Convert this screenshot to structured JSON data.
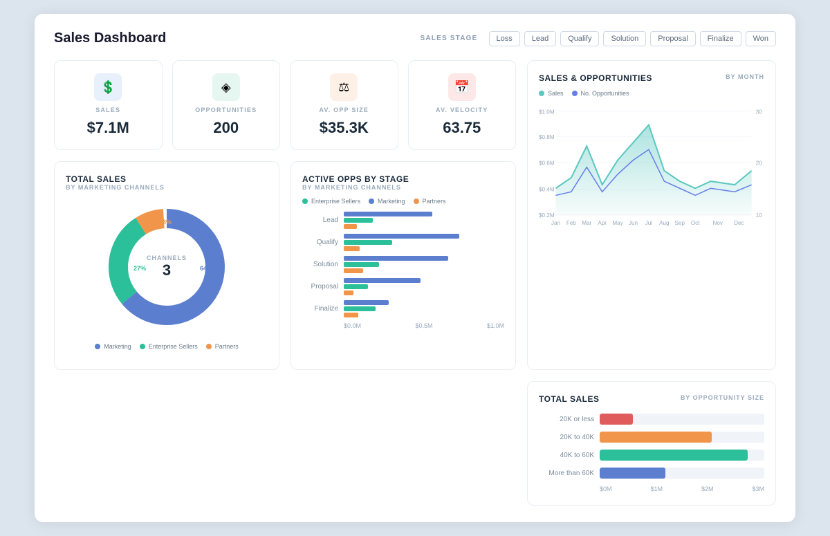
{
  "header": {
    "title": "Sales Dashboard",
    "sales_stage_label": "SALES STAGE",
    "stage_buttons": [
      "Loss",
      "Lead",
      "Qualify",
      "Solution",
      "Proposal",
      "Finalize",
      "Won"
    ]
  },
  "kpis": [
    {
      "label": "SALES",
      "value": "$7.1M",
      "icon": "💲",
      "icon_bg": "#e8f0fb",
      "icon_color": "#5b7fce"
    },
    {
      "label": "OPPORTUNITIES",
      "value": "200",
      "icon": "◈",
      "icon_bg": "#e6f7f2",
      "icon_color": "#2bbf9a"
    },
    {
      "label": "AV. OPP SIZE",
      "value": "$35.3K",
      "icon": "⚖",
      "icon_bg": "#fdf0e6",
      "icon_color": "#f0954a"
    },
    {
      "label": "AV. VELOCITY",
      "value": "63.75",
      "icon": "📅",
      "icon_bg": "#fde8e8",
      "icon_color": "#e05c5c"
    }
  ],
  "sales_opps_chart": {
    "title": "SALES & OPPORTUNITIES",
    "subtitle": "BY MONTH",
    "legend": [
      {
        "label": "Sales",
        "color": "#5bc8c0"
      },
      {
        "label": "No. Opportunities",
        "color": "#667eea"
      }
    ],
    "y_labels": [
      "$1.0M",
      "$0.8M",
      "$0.6M",
      "$0.4M",
      "$0.2M"
    ],
    "x_labels": [
      "Jan",
      "Feb",
      "Mar",
      "Apr",
      "May",
      "Jun",
      "Jul",
      "Aug",
      "Sep",
      "Oct",
      "Nov",
      "Dec"
    ],
    "y2_labels": [
      "30",
      "20",
      "10"
    ]
  },
  "total_sales_donut": {
    "title": "TOTAL SALES",
    "subtitle": "BY MARKETING CHANNELS",
    "center_label": "CHANNELS",
    "center_value": "3",
    "segments": [
      {
        "label": "Marketing",
        "color": "#5b7fce",
        "percent": 64,
        "percent_label": "64%"
      },
      {
        "label": "Enterprise Sellers",
        "color": "#2bbf9a",
        "percent": 27,
        "percent_label": "27%"
      },
      {
        "label": "Partners",
        "color": "#f0954a",
        "percent": 8,
        "percent_label": "8%"
      }
    ],
    "legend": [
      {
        "label": "Marketing",
        "color": "#5b7fce"
      },
      {
        "label": "Enterprise Sellers",
        "color": "#2bbf9a"
      },
      {
        "label": "Partners",
        "color": "#f0954a"
      }
    ]
  },
  "active_opps": {
    "title": "ACTIVE OPPS BY STAGE",
    "subtitle": "BY MARKETING CHANNELS",
    "legend": [
      {
        "label": "Enterprise Sellers",
        "color": "#2bbf9a"
      },
      {
        "label": "Marketing",
        "color": "#5b7fce"
      },
      {
        "label": "Partners",
        "color": "#f0954a"
      }
    ],
    "stages": [
      {
        "label": "Lead",
        "bars": [
          {
            "color": "#5b7fce",
            "width_pct": 55
          },
          {
            "color": "#2bbf9a",
            "width_pct": 18
          },
          {
            "color": "#f0954a",
            "width_pct": 8
          }
        ]
      },
      {
        "label": "Qualify",
        "bars": [
          {
            "color": "#5b7fce",
            "width_pct": 72
          },
          {
            "color": "#2bbf9a",
            "width_pct": 30
          },
          {
            "color": "#f0954a",
            "width_pct": 10
          }
        ]
      },
      {
        "label": "Solution",
        "bars": [
          {
            "color": "#5b7fce",
            "width_pct": 65
          },
          {
            "color": "#2bbf9a",
            "width_pct": 22
          },
          {
            "color": "#f0954a",
            "width_pct": 12
          }
        ]
      },
      {
        "label": "Proposal",
        "bars": [
          {
            "color": "#5b7fce",
            "width_pct": 48
          },
          {
            "color": "#2bbf9a",
            "width_pct": 15
          },
          {
            "color": "#f0954a",
            "width_pct": 6
          }
        ]
      },
      {
        "label": "Finalize",
        "bars": [
          {
            "color": "#5b7fce",
            "width_pct": 28
          },
          {
            "color": "#2bbf9a",
            "width_pct": 20
          },
          {
            "color": "#f0954a",
            "width_pct": 9
          }
        ]
      }
    ],
    "x_axis": [
      "$0.0M",
      "$0.5M",
      "$1.0M"
    ]
  },
  "total_sales_opp_size": {
    "title": "TOTAL SALES",
    "subtitle": "BY OPPORTUNITY SIZE",
    "bars": [
      {
        "label": "20K or less",
        "color": "#e05c5c",
        "width_pct": 20
      },
      {
        "label": "20K to 40K",
        "color": "#f0954a",
        "width_pct": 68
      },
      {
        "label": "40K to 60K",
        "color": "#2bbf9a",
        "width_pct": 90
      },
      {
        "label": "More than 60K",
        "color": "#5b7fce",
        "width_pct": 40
      }
    ],
    "x_axis": [
      "$0M",
      "$1M",
      "$2M",
      "$3M"
    ]
  }
}
